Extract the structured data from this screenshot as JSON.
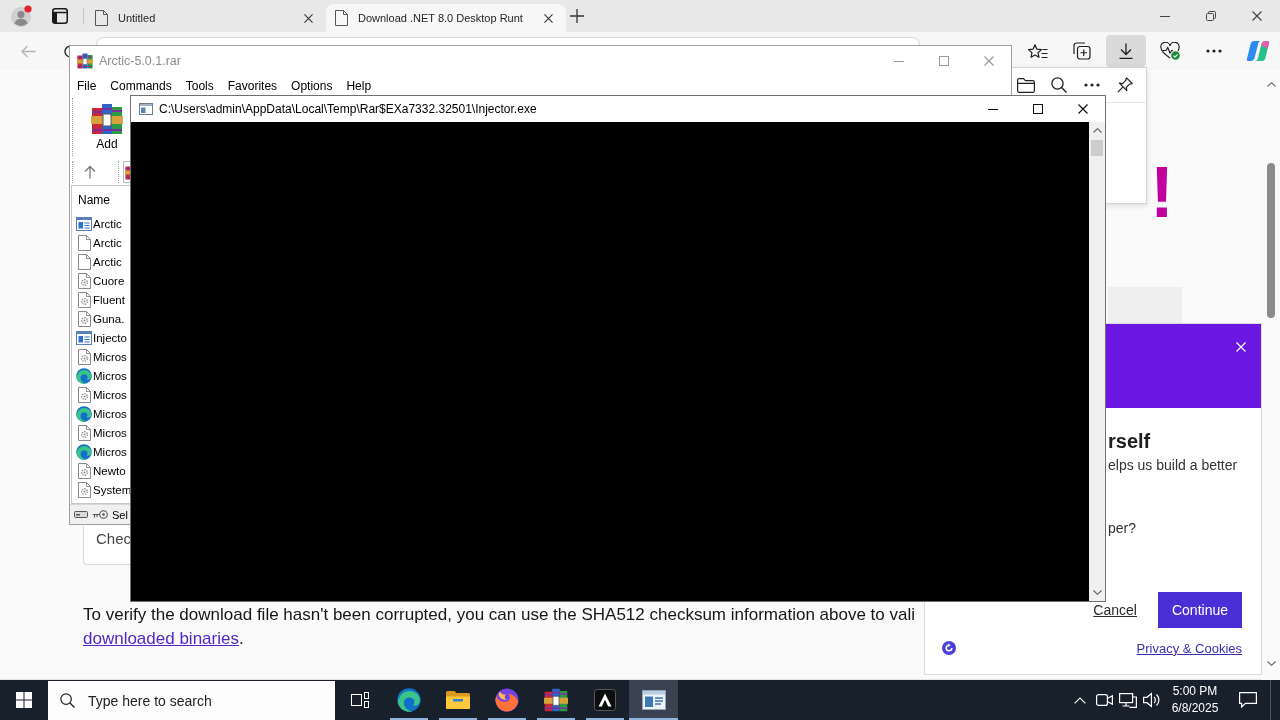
{
  "browser": {
    "profile": {
      "notification": true
    },
    "tabs": [
      {
        "label": "Untitled",
        "selected": false
      },
      {
        "label": "Download .NET 8.0 Desktop Runt",
        "selected": true
      }
    ],
    "back": {
      "disabled": true
    },
    "toolbar_buttons": [
      {
        "kind": "favorites",
        "selected": false
      },
      {
        "kind": "collections",
        "selected": false
      },
      {
        "kind": "downloads",
        "selected": true
      },
      {
        "kind": "essentials",
        "selected": false
      },
      {
        "kind": "more",
        "selected": false
      },
      {
        "kind": "copilot",
        "selected": false
      }
    ]
  },
  "page": {
    "heading_fragment": "!",
    "card_text": "Chec",
    "note": {
      "text": "To verify the download file hasn't been corrupted, you can use the SHA512 checksum information above to vali",
      "link": "downloaded binaries",
      "tail": "."
    }
  },
  "consent_dialog": {
    "heading": "rself",
    "lines": [
      "elps us build a better",
      "per?"
    ],
    "cancel": "Cancel",
    "continue": "Continue",
    "privacy_link": "Privacy & Cookies"
  },
  "archive_window": {
    "title": "Arctic-5.0.1.rar",
    "menu": [
      "File",
      "Commands",
      "Tools",
      "Favorites",
      "Options",
      "Help"
    ],
    "toolbar": [
      "Add"
    ],
    "column": "Name",
    "files": [
      {
        "name": "Arctic",
        "kind": "app"
      },
      {
        "name": "Arctic",
        "kind": "file"
      },
      {
        "name": "Arctic",
        "kind": "file"
      },
      {
        "name": "Cuore",
        "kind": "library"
      },
      {
        "name": "Fluent",
        "kind": "library"
      },
      {
        "name": "Guna.",
        "kind": "library"
      },
      {
        "name": "Injecto",
        "kind": "app"
      },
      {
        "name": "Micros",
        "kind": "library"
      },
      {
        "name": "Micros",
        "kind": "web"
      },
      {
        "name": "Micros",
        "kind": "library"
      },
      {
        "name": "Micros",
        "kind": "web"
      },
      {
        "name": "Micros",
        "kind": "library"
      },
      {
        "name": "Micros",
        "kind": "web"
      },
      {
        "name": "Newto",
        "kind": "library"
      },
      {
        "name": "System",
        "kind": "library"
      }
    ],
    "status": "Sel"
  },
  "console_window": {
    "title": "C:\\Users\\admin\\AppData\\Local\\Temp\\Rar$EXa7332.32501\\Injector.exe"
  },
  "taskbar": {
    "search": {
      "placeholder": "Type here to search"
    },
    "apps": [
      {
        "kind": "task-view",
        "running": false,
        "selected": false
      },
      {
        "kind": "browser",
        "running": true,
        "selected": false
      },
      {
        "kind": "files",
        "running": true,
        "selected": false
      },
      {
        "kind": "browser-alt",
        "running": true,
        "selected": false
      },
      {
        "kind": "archiver",
        "running": true,
        "selected": false
      },
      {
        "kind": "launcher",
        "running": true,
        "selected": false
      },
      {
        "kind": "console",
        "running": true,
        "selected": true
      }
    ],
    "clock": {
      "time": "5:00 PM",
      "date": "6/8/2025"
    }
  }
}
